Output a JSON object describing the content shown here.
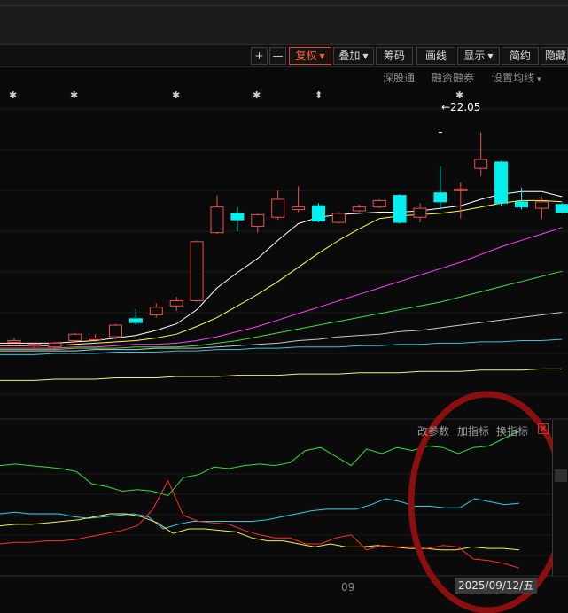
{
  "toolbar": {
    "plus": "+",
    "minus": "—",
    "fuquan": "复权",
    "diejia": "叠加",
    "chouma": "筹码",
    "huaxian": "画线",
    "xianshi": "显示",
    "jianyue": "简约",
    "yincang": "隐藏"
  },
  "top_links": {
    "shengutong": "深股通",
    "rongzirongquan": "融资融券",
    "set_ma": "设置均线",
    "set_ma_caret": "▾"
  },
  "annotations": {
    "star": "✱",
    "arrow_mark": "⬍",
    "max_label": "←22.05"
  },
  "indicator_panel": {
    "change_params": "改参数",
    "add_indicator": "加指标",
    "switch_indicator": "换指标",
    "close_glyph": "✕"
  },
  "x_axis": {
    "month_label": "09",
    "cursor_date": "2025/09/12/五"
  },
  "colors": {
    "up": "#f0504a",
    "down": "#00f0f0",
    "active_button": "#ff5a2e",
    "ma5": "#ffffff",
    "ma10": "#ffff40",
    "ma20": "#ff40ff",
    "ma30": "#40e040",
    "ma60": "#c8c8c8",
    "ma120": "#40c0e0",
    "ma250": "#f0f080",
    "ind_green": "#33dd33",
    "ind_cyan": "#33ccee",
    "ind_yellow": "#eeee55",
    "ind_red": "#ff3030",
    "annotation_ellipse": "#8b0f0f"
  },
  "chart_data": {
    "type": "candlestick",
    "price_min": 11,
    "price_max": 23,
    "note_max": 22.05,
    "candles": [
      {
        "o": 13.9,
        "h": 14.05,
        "l": 13.85,
        "c": 13.95
      },
      {
        "o": 13.75,
        "h": 13.85,
        "l": 13.65,
        "c": 13.8
      },
      {
        "o": 13.7,
        "h": 13.9,
        "l": 13.6,
        "c": 13.85
      },
      {
        "o": 13.95,
        "h": 14.25,
        "l": 13.9,
        "c": 14.2
      },
      {
        "o": 14.0,
        "h": 14.2,
        "l": 13.9,
        "c": 14.05
      },
      {
        "o": 14.1,
        "h": 14.6,
        "l": 14.0,
        "c": 14.55
      },
      {
        "o": 14.8,
        "h": 15.2,
        "l": 14.55,
        "c": 14.65
      },
      {
        "o": 14.95,
        "h": 15.4,
        "l": 14.85,
        "c": 15.25
      },
      {
        "o": 15.3,
        "h": 15.65,
        "l": 15.1,
        "c": 15.5
      },
      {
        "o": 15.5,
        "h": 17.85,
        "l": 15.45,
        "c": 17.8
      },
      {
        "o": 18.15,
        "h": 19.6,
        "l": 18.1,
        "c": 19.15
      },
      {
        "o": 18.9,
        "h": 19.15,
        "l": 18.2,
        "c": 18.65
      },
      {
        "o": 18.4,
        "h": 18.9,
        "l": 18.15,
        "c": 18.85
      },
      {
        "o": 18.75,
        "h": 19.8,
        "l": 18.65,
        "c": 19.45
      },
      {
        "o": 19.05,
        "h": 19.95,
        "l": 18.95,
        "c": 19.15
      },
      {
        "o": 19.2,
        "h": 19.3,
        "l": 18.55,
        "c": 18.6
      },
      {
        "o": 18.55,
        "h": 18.95,
        "l": 18.5,
        "c": 18.9
      },
      {
        "o": 19.0,
        "h": 19.25,
        "l": 18.95,
        "c": 19.15
      },
      {
        "o": 19.15,
        "h": 19.45,
        "l": 19.1,
        "c": 19.4
      },
      {
        "o": 19.6,
        "h": 19.65,
        "l": 18.5,
        "c": 18.55
      },
      {
        "o": 18.75,
        "h": 19.3,
        "l": 18.55,
        "c": 19.1
      },
      {
        "o": 19.7,
        "h": 20.75,
        "l": 19.05,
        "c": 19.35
      },
      {
        "o": 19.85,
        "h": 20.1,
        "l": 18.7,
        "c": 19.85
      },
      {
        "o": 20.65,
        "h": 22.05,
        "l": 20.35,
        "c": 21.0
      },
      {
        "o": 20.9,
        "h": 20.95,
        "l": 19.2,
        "c": 19.3
      },
      {
        "o": 19.35,
        "h": 19.9,
        "l": 19.05,
        "c": 19.15
      },
      {
        "o": 19.1,
        "h": 19.55,
        "l": 18.7,
        "c": 19.35
      },
      {
        "o": 19.25,
        "h": 19.3,
        "l": 18.9,
        "c": 18.95
      }
    ],
    "ma_lines": [
      {
        "id": "ma5",
        "values": [
          13.85,
          13.85,
          13.85,
          13.9,
          13.95,
          14.05,
          14.15,
          14.35,
          14.6,
          15.15,
          16.0,
          16.6,
          17.15,
          17.85,
          18.5,
          18.75,
          18.85,
          18.9,
          18.95,
          18.95,
          19.0,
          19.1,
          19.2,
          19.45,
          19.65,
          19.75,
          19.75,
          19.55
        ]
      },
      {
        "id": "ma10",
        "values": [
          13.75,
          13.75,
          13.75,
          13.8,
          13.85,
          13.9,
          13.95,
          14.05,
          14.2,
          14.5,
          14.85,
          15.3,
          15.75,
          16.25,
          16.8,
          17.35,
          17.85,
          18.3,
          18.7,
          18.8,
          18.85,
          18.9,
          19.0,
          19.15,
          19.3,
          19.4,
          19.4,
          19.35
        ]
      },
      {
        "id": "ma20",
        "values": [
          13.65,
          13.65,
          13.65,
          13.7,
          13.7,
          13.75,
          13.8,
          13.8,
          13.85,
          13.95,
          14.1,
          14.3,
          14.5,
          14.75,
          15.0,
          15.25,
          15.5,
          15.75,
          16.0,
          16.25,
          16.5,
          16.75,
          17.0,
          17.3,
          17.6,
          17.85,
          18.1,
          18.35
        ]
      },
      {
        "id": "ma30",
        "values": [
          13.6,
          13.6,
          13.6,
          13.65,
          13.65,
          13.65,
          13.7,
          13.7,
          13.7,
          13.75,
          13.85,
          13.95,
          14.1,
          14.25,
          14.4,
          14.55,
          14.7,
          14.85,
          15.0,
          15.15,
          15.3,
          15.45,
          15.65,
          15.85,
          16.05,
          16.25,
          16.45,
          16.65
        ]
      },
      {
        "id": "ma60",
        "values": [
          13.55,
          13.55,
          13.55,
          13.55,
          13.6,
          13.6,
          13.6,
          13.65,
          13.65,
          13.65,
          13.7,
          13.75,
          13.8,
          13.85,
          13.95,
          14.0,
          14.1,
          14.15,
          14.2,
          14.3,
          14.35,
          14.45,
          14.55,
          14.65,
          14.75,
          14.85,
          14.95,
          15.05
        ]
      },
      {
        "id": "ma120",
        "values": [
          13.4,
          13.4,
          13.45,
          13.45,
          13.45,
          13.5,
          13.5,
          13.5,
          13.55,
          13.55,
          13.6,
          13.6,
          13.65,
          13.65,
          13.7,
          13.7,
          13.7,
          13.75,
          13.75,
          13.8,
          13.8,
          13.85,
          13.85,
          13.9,
          13.9,
          13.95,
          13.95,
          14.0
        ]
      },
      {
        "id": "ma250",
        "values": [
          12.4,
          12.4,
          12.45,
          12.45,
          12.45,
          12.5,
          12.5,
          12.5,
          12.55,
          12.55,
          12.55,
          12.6,
          12.6,
          12.6,
          12.65,
          12.65,
          12.65,
          12.7,
          12.7,
          12.7,
          12.75,
          12.75,
          12.75,
          12.8,
          12.8,
          12.8,
          12.85,
          12.85
        ]
      }
    ],
    "indicator": {
      "y_min": 0,
      "y_max": 100,
      "series": [
        {
          "id": "ind_green",
          "values": [
            72,
            73,
            72,
            71,
            70,
            68,
            60,
            58,
            55,
            56,
            55,
            52,
            64,
            66,
            71,
            70,
            72,
            73,
            72,
            74,
            82,
            84,
            78,
            72,
            83,
            80,
            84,
            82,
            85,
            84,
            80,
            84,
            85,
            90,
            95
          ]
        },
        {
          "id": "ind_cyan",
          "values": [
            40,
            41,
            40,
            40,
            40,
            38,
            37,
            38,
            39,
            40,
            38,
            30,
            33,
            35,
            35,
            35,
            35,
            35,
            36,
            38,
            40,
            42,
            43,
            43,
            43,
            46,
            50,
            48,
            45,
            45,
            44,
            44,
            50,
            48,
            46,
            47
          ]
        },
        {
          "id": "ind_yellow",
          "values": [
            32,
            33,
            33,
            34,
            35,
            36,
            38,
            40,
            40,
            38,
            34,
            27,
            30,
            30,
            29,
            28,
            24,
            22,
            22,
            20,
            18,
            20,
            18,
            18,
            19,
            18,
            17,
            17,
            16,
            16,
            18,
            17,
            17,
            16
          ]
        },
        {
          "id": "ind_red",
          "values": [
            20,
            21,
            21,
            22,
            22,
            23,
            25,
            27,
            29,
            32,
            43,
            62,
            39,
            35,
            34,
            33,
            29,
            26,
            24,
            24,
            20,
            20,
            24,
            26,
            16,
            19,
            18,
            18,
            17,
            19,
            18,
            10,
            9,
            7,
            4
          ]
        }
      ]
    }
  }
}
